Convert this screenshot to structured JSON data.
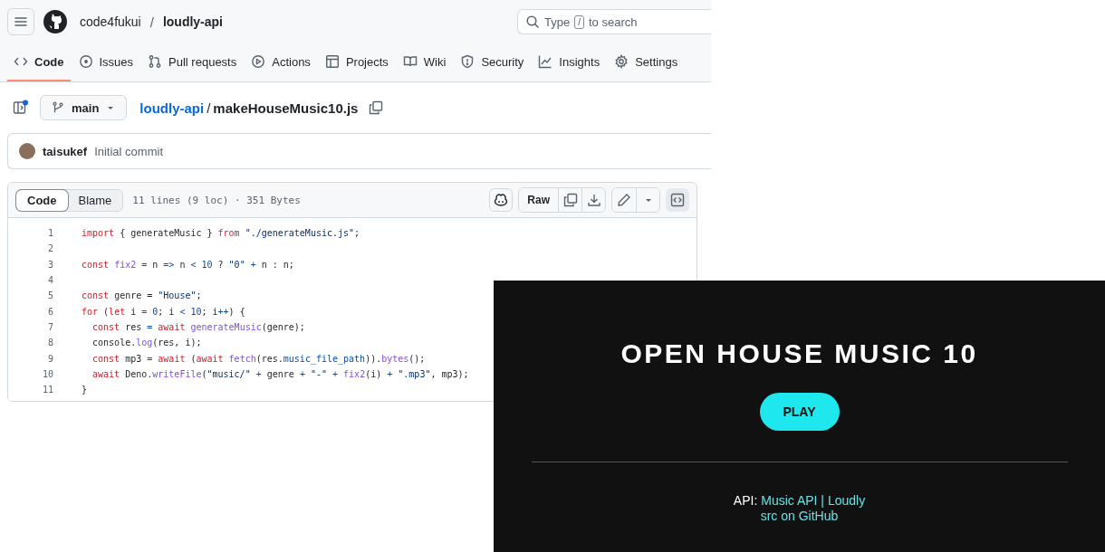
{
  "header": {
    "owner": "code4fukui",
    "separator": "/",
    "repo": "loudly-api",
    "search": {
      "before": "Type",
      "key": "/",
      "after": "to search"
    }
  },
  "nav_tabs": [
    {
      "label": "Code",
      "selected": true
    },
    {
      "label": "Issues",
      "selected": false
    },
    {
      "label": "Pull requests",
      "selected": false
    },
    {
      "label": "Actions",
      "selected": false
    },
    {
      "label": "Projects",
      "selected": false
    },
    {
      "label": "Wiki",
      "selected": false
    },
    {
      "label": "Security",
      "selected": false
    },
    {
      "label": "Insights",
      "selected": false
    },
    {
      "label": "Settings",
      "selected": false
    }
  ],
  "file_bar": {
    "branch": "main",
    "repo_link": "loudly-api",
    "separator": "/",
    "file_name": "makeHouseMusic10.js"
  },
  "commit": {
    "author": "taisukef",
    "message": "Initial commit"
  },
  "code_view": {
    "tabs": [
      {
        "label": "Code",
        "selected": true
      },
      {
        "label": "Blame",
        "selected": false
      }
    ],
    "info": "11 lines (9 loc) · 351 Bytes",
    "raw_button": "Raw",
    "lines": [
      {
        "number": "1",
        "tokens": [
          {
            "kind": "kw",
            "text": "import"
          },
          {
            "kind": "plain",
            "text": " { generateMusic } "
          },
          {
            "kind": "kw",
            "text": "from"
          },
          {
            "kind": "str",
            "text": " \"./generateMusic.js\""
          },
          {
            "kind": "plain",
            "text": ";"
          }
        ]
      },
      {
        "number": "2"
      },
      {
        "number": "3",
        "tokens": [
          {
            "kind": "kw",
            "text": "const"
          },
          {
            "kind": "fn",
            "text": " fix2"
          },
          {
            "kind": "op",
            "text": " ="
          },
          {
            "kind": "plain",
            "text": " n "
          },
          {
            "kind": "op",
            "text": "=>"
          },
          {
            "kind": "plain",
            "text": " n "
          },
          {
            "kind": "op",
            "text": "< 10"
          },
          {
            "kind": "plain",
            "text": " ? "
          },
          {
            "kind": "str",
            "text": "\"0\""
          },
          {
            "kind": "op",
            "text": " +"
          },
          {
            "kind": "plain",
            "text": " n : n;"
          }
        ]
      },
      {
        "number": "4"
      },
      {
        "number": "5",
        "tokens": [
          {
            "kind": "kw",
            "text": "const"
          },
          {
            "kind": "plain",
            "text": " genre = "
          },
          {
            "kind": "str",
            "text": "\"House\""
          },
          {
            "kind": "plain",
            "text": ";"
          }
        ]
      },
      {
        "number": "6",
        "tokens": [
          {
            "kind": "kw",
            "text": "for"
          },
          {
            "kind": "plain",
            "text": " ("
          },
          {
            "kind": "kw",
            "text": "let"
          },
          {
            "kind": "plain",
            "text": " i "
          },
          {
            "kind": "op",
            "text": "= 0"
          },
          {
            "kind": "plain",
            "text": "; i "
          },
          {
            "kind": "op",
            "text": "< 10"
          },
          {
            "kind": "plain",
            "text": "; i"
          },
          {
            "kind": "op",
            "text": "++"
          },
          {
            "kind": "plain",
            "text": ") {"
          }
        ]
      },
      {
        "number": "7",
        "tokens": [
          {
            "kind": "kw",
            "text": "  const"
          },
          {
            "kind": "plain",
            "text": " res "
          },
          {
            "kind": "op",
            "text": "="
          },
          {
            "kind": "kw",
            "text": " await"
          },
          {
            "kind": "fn",
            "text": " generateMusic"
          },
          {
            "kind": "plain",
            "text": "(genre);"
          }
        ]
      },
      {
        "number": "8",
        "tokens": [
          {
            "kind": "plain",
            "text": "  console."
          },
          {
            "kind": "fn",
            "text": "log"
          },
          {
            "kind": "plain",
            "text": "(res, i);"
          }
        ]
      },
      {
        "number": "9",
        "tokens": [
          {
            "kind": "kw",
            "text": "  const"
          },
          {
            "kind": "plain",
            "text": " mp3 "
          },
          {
            "kind": "op",
            "text": "="
          },
          {
            "kind": "kw",
            "text": " await"
          },
          {
            "kind": "plain",
            "text": " ("
          },
          {
            "kind": "kw",
            "text": "await"
          },
          {
            "kind": "fn",
            "text": " fetch"
          },
          {
            "kind": "plain",
            "text": "(res."
          },
          {
            "kind": "op",
            "text": "music_file_path"
          },
          {
            "kind": "plain",
            "text": "))."
          },
          {
            "kind": "fn",
            "text": "bytes"
          },
          {
            "kind": "plain",
            "text": "();"
          }
        ]
      },
      {
        "number": "10",
        "tokens": [
          {
            "kind": "kw",
            "text": "  await"
          },
          {
            "kind": "plain",
            "text": " Deno."
          },
          {
            "kind": "fn",
            "text": "writeFile"
          },
          {
            "kind": "plain",
            "text": "("
          },
          {
            "kind": "str",
            "text": "\"music/\""
          },
          {
            "kind": "op",
            "text": " +"
          },
          {
            "kind": "plain",
            "text": " genre "
          },
          {
            "kind": "op",
            "text": "+"
          },
          {
            "kind": "str",
            "text": " \"-\""
          },
          {
            "kind": "op",
            "text": " +"
          },
          {
            "kind": "fn",
            "text": " fix2"
          },
          {
            "kind": "plain",
            "text": "(i) "
          },
          {
            "kind": "op",
            "text": "+"
          },
          {
            "kind": "str",
            "text": " \".mp3\""
          },
          {
            "kind": "plain",
            "text": ", mp3);"
          }
        ]
      },
      {
        "number": "11",
        "tokens": [
          {
            "kind": "plain",
            "text": "}"
          }
        ]
      }
    ]
  },
  "app_panel": {
    "title": "OPEN HOUSE MUSIC 10",
    "play_button": "PLAY",
    "api_label": "API:",
    "api_link": "Music API | Loudly",
    "src_link": "src on GitHub"
  }
}
